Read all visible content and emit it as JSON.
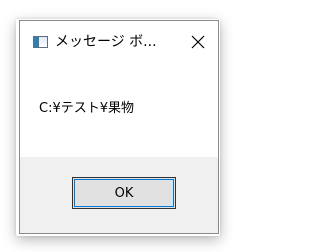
{
  "window": {
    "title": "メッセージ ボ...",
    "close_icon": "close-icon",
    "app_icon": "window-icon"
  },
  "message": {
    "text": "C:¥テスト¥果物"
  },
  "buttons": {
    "ok_label": "OK"
  },
  "colors": {
    "window_bg": "#ffffff",
    "footer_bg": "#f0f0f0",
    "button_bg": "#e1e1e1",
    "focus_border": "#0078d7"
  }
}
